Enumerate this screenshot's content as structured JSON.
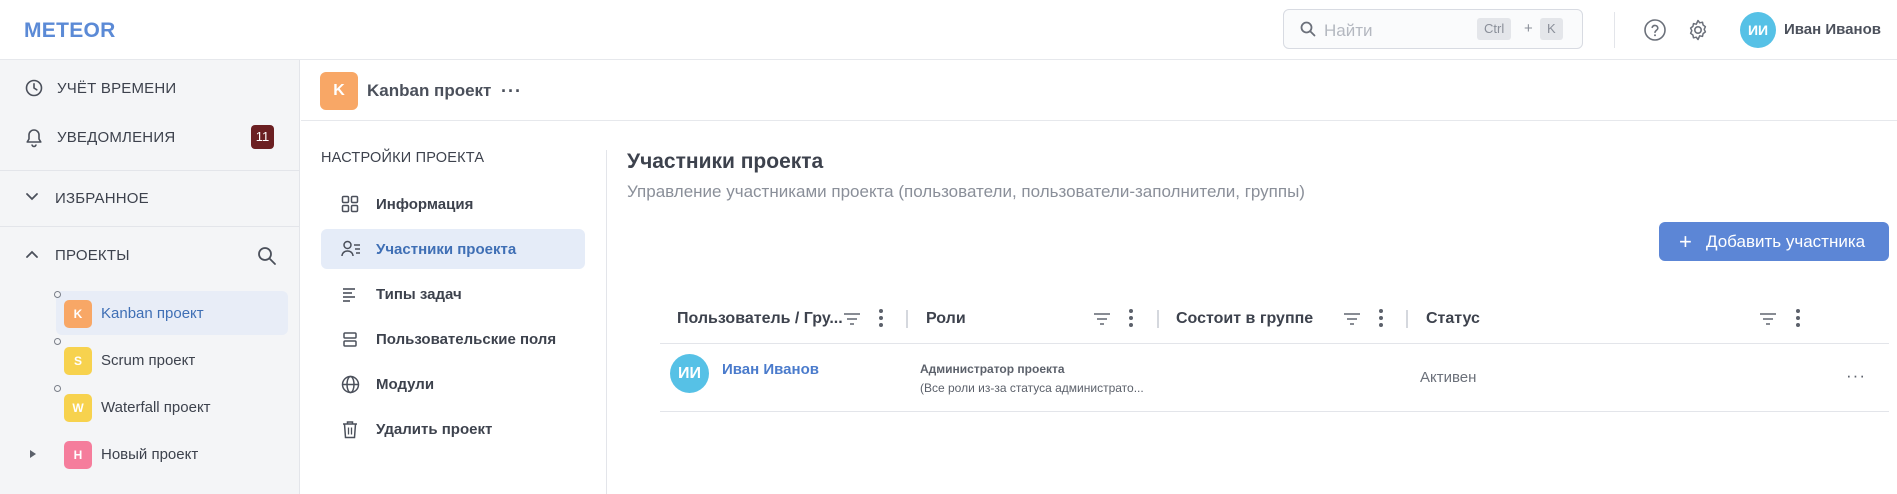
{
  "header": {
    "logo": "METEOR",
    "search_placeholder": "Найти",
    "shortcut_ctrl": "Ctrl",
    "shortcut_plus": "+",
    "shortcut_key": "K",
    "user_initials": "ИИ",
    "user_name": "Иван Иванов"
  },
  "sidebar": {
    "time_tracking": "УЧЁТ ВРЕМЕНИ",
    "notifications": "УВЕДОМЛЕНИЯ",
    "notifications_count": "11",
    "favorites": "ИЗБРАННОЕ",
    "projects": "ПРОЕКТЫ",
    "project_list": [
      {
        "letter": "K",
        "name": "Kanban проект",
        "color": "#f8a766"
      },
      {
        "letter": "S",
        "name": "Scrum проект",
        "color": "#f7d24e"
      },
      {
        "letter": "W",
        "name": "Waterfall проект",
        "color": "#f7d24e"
      },
      {
        "letter": "Н",
        "name": "Новый проект",
        "color": "#f57d9c"
      }
    ]
  },
  "project_header": {
    "letter": "K",
    "title": "Kanban проект",
    "more": "···"
  },
  "settings_nav": {
    "title": "НАСТРОЙКИ ПРОЕКТА",
    "items": [
      {
        "label": "Информация",
        "icon": "grid-icon"
      },
      {
        "label": "Участники проекта",
        "icon": "members-icon"
      },
      {
        "label": "Типы задач",
        "icon": "list-icon"
      },
      {
        "label": "Пользовательские поля",
        "icon": "fields-icon"
      },
      {
        "label": "Модули",
        "icon": "globe-icon"
      },
      {
        "label": "Удалить проект",
        "icon": "trash-icon"
      }
    ]
  },
  "main": {
    "title": "Участники проекта",
    "subtitle": "Управление участниками проекта (пользователи, пользователи-заполнители, группы)",
    "add_button": "Добавить участника",
    "add_button_icon": "+",
    "columns": [
      "Пользователь / Гру...",
      "Роли",
      "Состоит в группе",
      "Статус"
    ],
    "rows": [
      {
        "initials": "ИИ",
        "user": "Иван Иванов",
        "role": "Администратор проекта",
        "role_note": "(Все роли из-за статуса администрато...",
        "group": "",
        "status": "Активен",
        "more": "···"
      }
    ]
  },
  "colors": {
    "accent": "#5c86d6",
    "logo": "#5b8ad6",
    "badge": "#6b1f22",
    "avatar": "#56c1e6"
  }
}
